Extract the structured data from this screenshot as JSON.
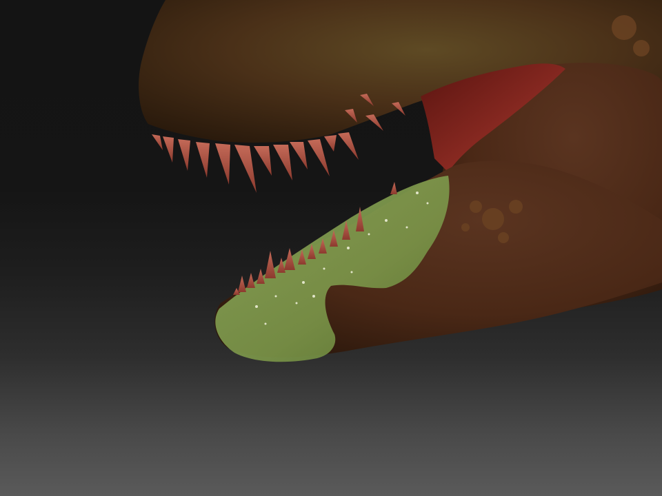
{
  "viewport": {
    "background_top": "#141414",
    "background_bottom": "#5a5a5a"
  },
  "model": {
    "subject": "dinosaur-head",
    "skin_color": "#4a3018",
    "skin_highlight": "#5e4a24",
    "mouth_color": "#7a1e1a",
    "tooth_color": "#b55a48",
    "painted_mask_color": "#7e9a4a"
  }
}
